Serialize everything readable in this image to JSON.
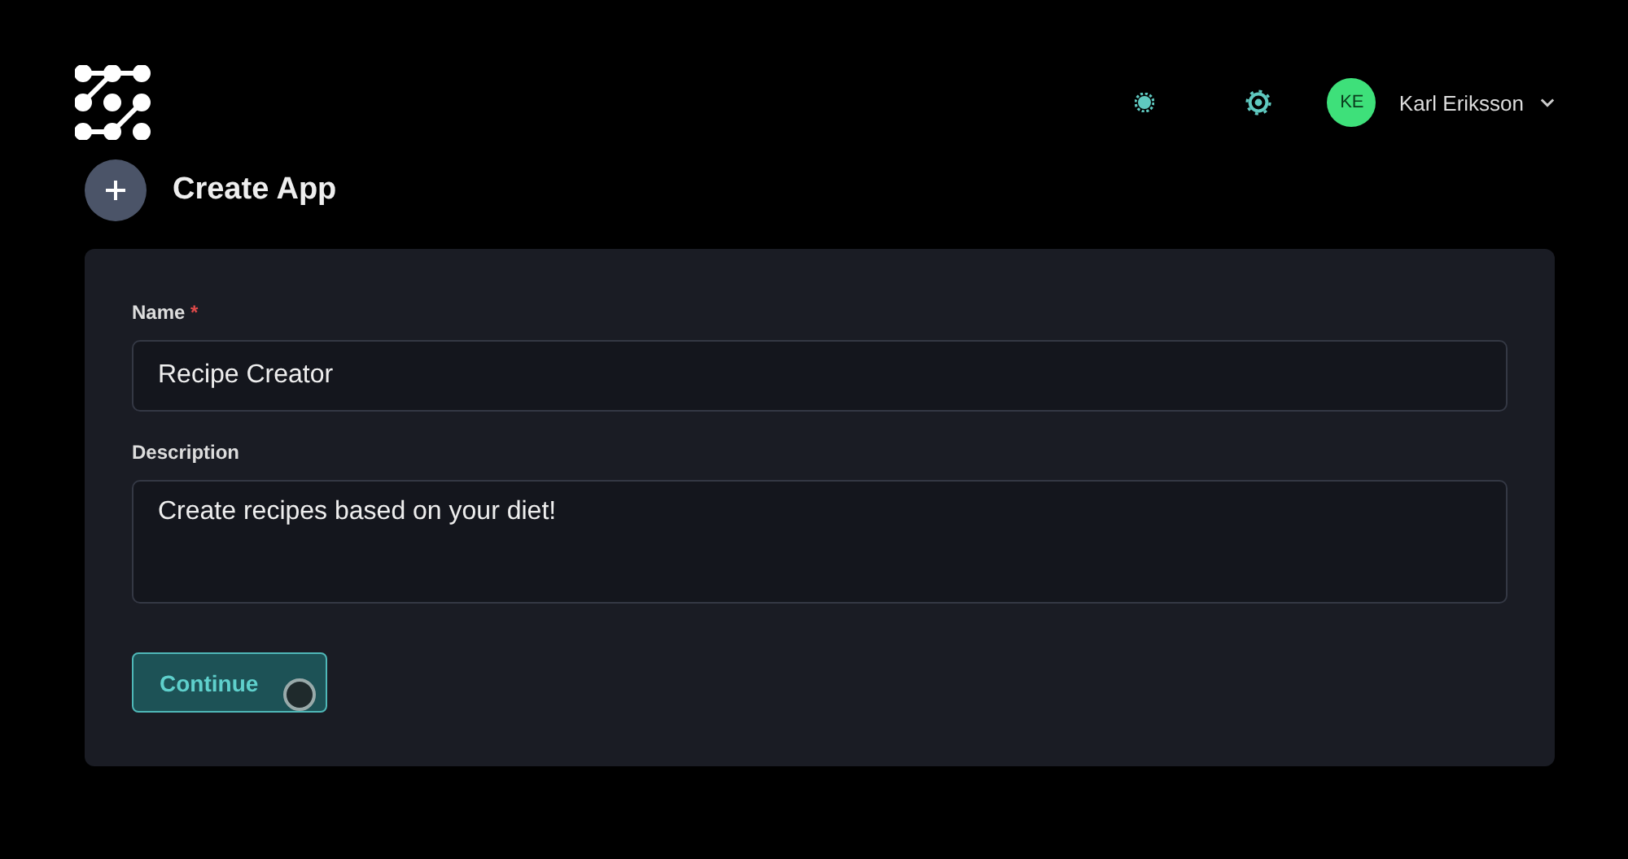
{
  "header": {
    "user": {
      "initials": "KE",
      "name": "Karl Eriksson"
    }
  },
  "page": {
    "title": "Create App"
  },
  "form": {
    "fields": [
      {
        "kind": "input",
        "label": "Name",
        "required_mark": "*",
        "value": "Recipe Creator"
      },
      {
        "kind": "textarea",
        "label": "Description",
        "value": "Create recipes based on your diet!"
      }
    ],
    "submit": {
      "label": "Continue"
    }
  }
}
